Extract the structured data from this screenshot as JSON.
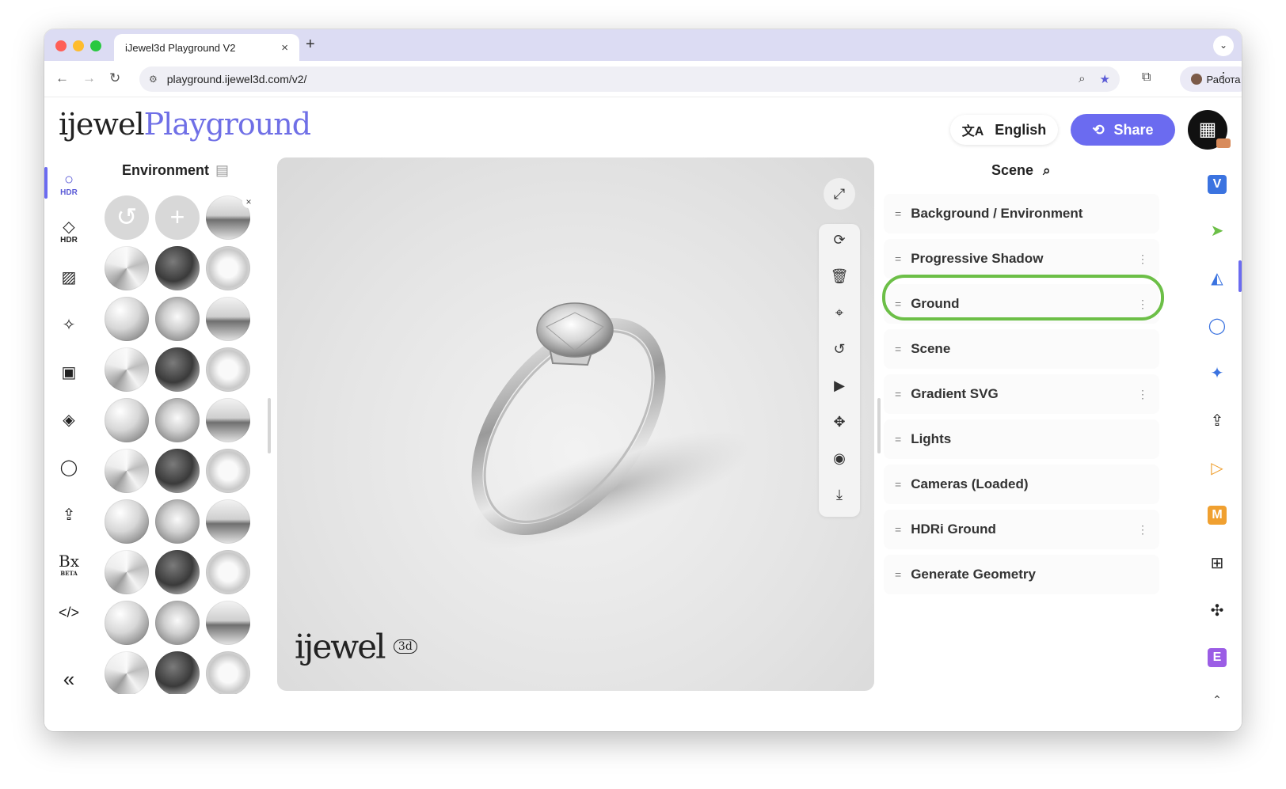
{
  "browser": {
    "tab_title": "iJewel3d Playground V2",
    "tab_close": "×",
    "new_tab": "+",
    "url": "playground.ijewel3d.com/v2/",
    "profile_name": "Работа"
  },
  "header": {
    "logo_part1": "ijewel",
    "logo_part2": "Playground",
    "language": "English",
    "share": "Share"
  },
  "left_rail": {
    "items": [
      {
        "icon": "hdr-circle-icon",
        "label": "HDR"
      },
      {
        "icon": "diamond-hdr-icon",
        "label": "HDR"
      },
      {
        "icon": "hatch-icon"
      },
      {
        "icon": "sparkle-icon"
      },
      {
        "icon": "image-frame-icon"
      },
      {
        "icon": "ground-plane-icon"
      },
      {
        "icon": "ring-icon"
      },
      {
        "icon": "upload-icon"
      },
      {
        "icon": "bx-beta-icon",
        "label": "BETA"
      },
      {
        "icon": "code-icon"
      }
    ],
    "collapse": "«"
  },
  "environment": {
    "title": "Environment"
  },
  "viewport": {
    "watermark": "ijewel",
    "watermark_badge": "3d"
  },
  "scene": {
    "title": "Scene",
    "items": [
      {
        "label": "Background / Environment",
        "has_menu": false
      },
      {
        "label": "Progressive Shadow",
        "has_menu": true
      },
      {
        "label": "Ground",
        "has_menu": true,
        "highlighted": true
      },
      {
        "label": "Scene",
        "has_menu": false
      },
      {
        "label": "Gradient SVG",
        "has_menu": true
      },
      {
        "label": "Lights",
        "has_menu": false
      },
      {
        "label": "Cameras (Loaded)",
        "has_menu": false
      },
      {
        "label": "HDRi Ground",
        "has_menu": true
      },
      {
        "label": "Generate Geometry",
        "has_menu": false
      }
    ]
  },
  "right_rail": {
    "items": [
      {
        "icon": "v-badge-icon",
        "label": "V",
        "color": "#3b73e0"
      },
      {
        "icon": "cursor-icon",
        "color": "#6cbf47"
      },
      {
        "icon": "shapes-icon",
        "color": "#3b73e0"
      },
      {
        "icon": "circle-icon",
        "color": "#3b73e0"
      },
      {
        "icon": "star-icon",
        "color": "#3b73e0"
      },
      {
        "icon": "upload-icon",
        "color": "#222"
      },
      {
        "icon": "play-icon",
        "color": "#f0a030"
      },
      {
        "icon": "m-badge-icon",
        "label": "M",
        "color": "#f0a030"
      },
      {
        "icon": "grid-icon",
        "color": "#222"
      },
      {
        "icon": "puzzle-icon",
        "color": "#222"
      },
      {
        "icon": "e-badge-icon",
        "label": "E",
        "color": "#9b5de5"
      }
    ]
  },
  "colors": {
    "accent": "#6b6bf0",
    "highlight": "#6cbf47"
  }
}
